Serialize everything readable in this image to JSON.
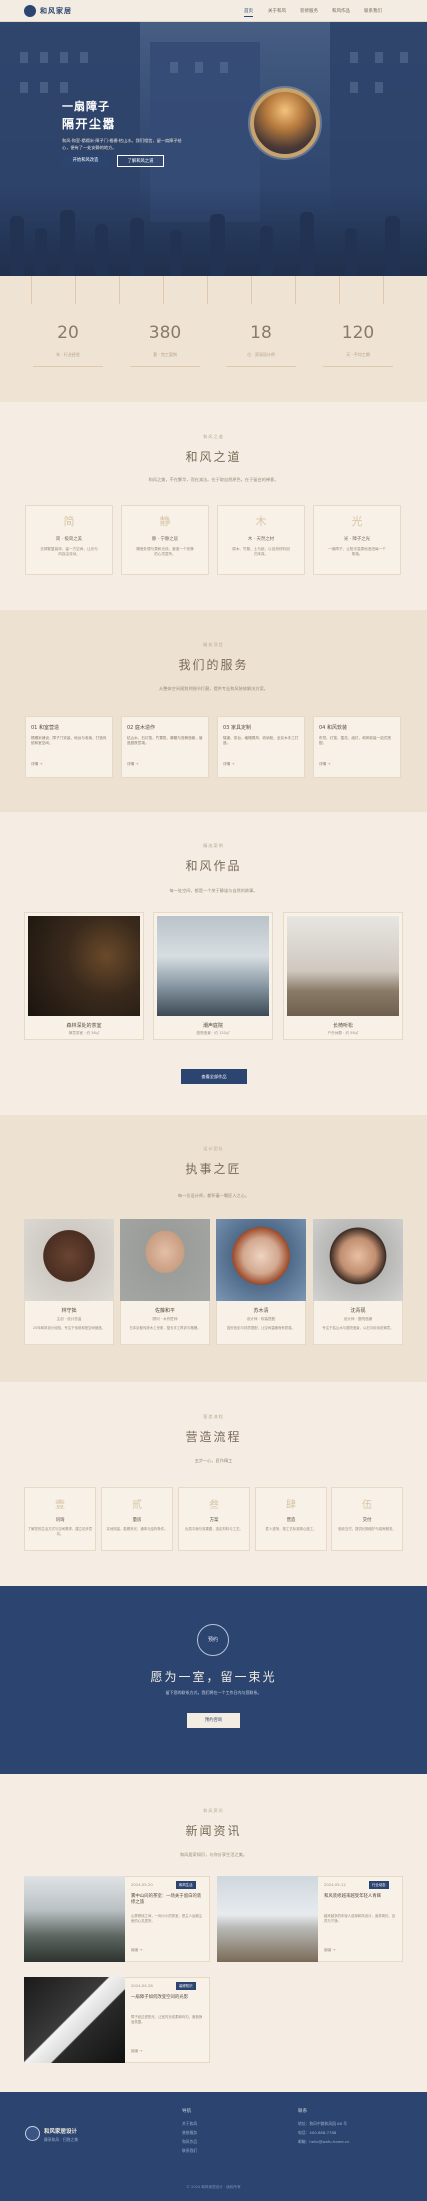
{
  "header": {
    "brand": "和风家居",
    "nav": [
      "首页",
      "关于和风",
      "装修服务",
      "和风作品",
      "联系我们"
    ]
  },
  "hero": {
    "title_line1": "一扇障子",
    "title_line2": "隔开尘嚣",
    "description": "和风·和室·榻榻米·障子门·格栅·枯山水。我们相信，留一扇障子给心，便有了一处安静的地方。",
    "primary_button": "开始和风改造",
    "secondary_button": "了解和风之道"
  },
  "stats": [
    {
      "value": "20",
      "label": "年 · 行业经验"
    },
    {
      "value": "380",
      "label": "套 · 完工案例"
    },
    {
      "value": "18",
      "label": "位 · 资深设计师"
    },
    {
      "value": "120",
      "label": "天 · 平均工期"
    }
  ],
  "dao": {
    "kicker": "和风之道",
    "title": "和风之道",
    "description": "和风之美，不在繁华，而在减法。在于取自然原色，在于留白的禅意。",
    "items": [
      {
        "char": "简",
        "name": "简 · 极简之美",
        "desc": "去掉繁复装饰，留一方空间，让光与风自由流动。"
      },
      {
        "char": "静",
        "name": "静 · 宁静之居",
        "desc": "隔音处理与柔和光线，营造一个安静的心灵居所。"
      },
      {
        "char": "木",
        "name": "木 · 天然之材",
        "desc": "原木、竹藤、土与纸，以自然材料回归本真。"
      },
      {
        "char": "光",
        "name": "光 · 障子之光",
        "desc": "一扇障子，让阳光温柔地洒进每一个角落。"
      }
    ]
  },
  "services": {
    "kicker": "服务项目",
    "title": "我们的服务",
    "description": "从整体空间规划到细节打磨，提供专业和风装修解决方案。",
    "items": [
      {
        "title": "01 和室营造",
        "desc": "榻榻米铺设、障子门安装、地台与收纳，打造传统和室空间。",
        "more": "详情 →"
      },
      {
        "title": "02 庭木造作",
        "desc": "枯山水、石灯笼、竹篱笆、蹲踞与苔藓造景，营造庭院意境。",
        "more": "详情 →"
      },
      {
        "title": "03 家具定制",
        "desc": "矮桌、茶台、格栅屏风、收纳柜，全实木手工打造。",
        "more": "详情 →"
      },
      {
        "title": "04 和风软装",
        "desc": "布帘、灯笼、插花、纸灯，和风软装一站式搭配。",
        "more": "详情 →"
      }
    ]
  },
  "works": {
    "kicker": "精选案例",
    "title": "和风作品",
    "description": "每一处空间，都是一个关于静谧与自然的故事。",
    "items": [
      {
        "title": "森林深处的茶室",
        "meta": "禅意茶室 · 约 36㎡"
      },
      {
        "title": "潮声庭院",
        "meta": "庭院造景 · 约 120㎡"
      },
      {
        "title": "长椅听松",
        "meta": "户外休憩 · 约 58㎡"
      }
    ],
    "button": "查看全部作品"
  },
  "team": {
    "kicker": "设计团队",
    "title": "执事之匠",
    "description": "每一位设计师，都怀着一颗匠人之心。",
    "members": [
      {
        "name": "林守拙",
        "role": "主创 · 设计总监",
        "desc": "20年和风设计经验，专注于传统和室空间营造。"
      },
      {
        "name": "佐藤和平",
        "role": "顾问 · 木作匠师",
        "desc": "日本京都传统木工世家，擅长手工榫卯与格栅。"
      },
      {
        "name": "苏木清",
        "role": "设计师 · 软装搭配",
        "desc": "擅长色彩与材质搭配，让空间温暖而有质感。"
      },
      {
        "name": "沈青砚",
        "role": "设计师 · 庭院造景",
        "desc": "专注于枯山水与庭院造景，以石与砂诉说禅意。"
      }
    ]
  },
  "process": {
    "kicker": "营造流程",
    "title": "营造流程",
    "description": "五步一心，匠作精工",
    "steps": [
      {
        "char": "壹",
        "name": "问询",
        "desc": "了解您的生活方式与空间需求，建立初步意向。"
      },
      {
        "char": "贰",
        "name": "量房",
        "desc": "实地测量，勘察采光、通风与结构条件。"
      },
      {
        "char": "叁",
        "name": "方案",
        "desc": "出具平面与效果图，选定材料与工艺。"
      },
      {
        "char": "肆",
        "name": "营造",
        "desc": "匠人进场，按工艺标准精心施工。"
      },
      {
        "char": "伍",
        "name": "交付",
        "desc": "验收交付，提供长期维护与保养服务。"
      }
    ]
  },
  "cta": {
    "circle_label": "预约",
    "title": "愿为一室，留一束光",
    "description": "留下您的联系方式，我们将在一个工作日内与您联系。",
    "button": "预约咨询"
  },
  "news": {
    "kicker": "和风资讯",
    "title": "新闻资讯",
    "description": "和风居家知识，与你分享生活之美。",
    "items": [
      {
        "date": "2024.05.20",
        "badge": "和风生活",
        "title": "雾中山间的茶室：一场关于留白的装修之旅",
        "desc": "山雾缭绕之间，一间小小的茶室，是主人远离尘嚣的心灵居所。",
        "more": "阅读 →"
      },
      {
        "date": "2024.05.12",
        "badge": "行业动态",
        "title": "和风装修越来越受年轻人青睐",
        "desc": "越来越多的年轻人选择和风设计，追求简约、自然与宁静。",
        "more": "阅读 →"
      },
      {
        "date": "2024.04.28",
        "badge": "装修知识",
        "title": "一扇障子如何改变空间的光影",
        "desc": "障子纸过滤阳光，让室内光线柔和均匀，营造静谧氛围。",
        "more": "阅读 →"
      }
    ]
  },
  "footer": {
    "brand": "和风家居设计",
    "tagline": "静享和风 · 归隐之美",
    "col1_title": "导航",
    "col1_links": [
      "关于和风",
      "装修服务",
      "和风作品",
      "联系我们"
    ],
    "col2_title": "联系",
    "col2_lines": [
      "地址：和风中路和风园 88 号",
      "电话：400-888-7788",
      "邮箱：hello@wafu-home.cn"
    ],
    "copyright": "© 2024 和风家居设计 · 版权所有"
  },
  "colors": {
    "navy": "#2b4470",
    "cream": "#f5ede3",
    "sand": "#ede2d2",
    "gold": "#c7a36e"
  }
}
